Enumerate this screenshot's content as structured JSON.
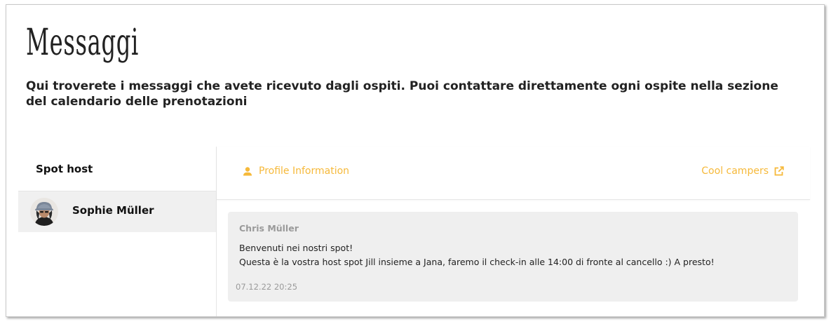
{
  "page": {
    "title": "Messaggi",
    "subtitle": "Qui troverete i messaggi che avete ricevuto dagli ospiti. Puoi contattare direttamente ogni ospite nella sezione del calendario delle prenotazioni"
  },
  "sidebar": {
    "header": "Spot host",
    "contacts": [
      {
        "name": "Sophie Müller",
        "avatar_icon": "avatar-photo"
      }
    ]
  },
  "chat": {
    "profile_link": {
      "label": "Profile Information",
      "icon": "person-icon"
    },
    "campers_link": {
      "label": "Cool campers",
      "icon": "external-link-icon"
    },
    "messages": [
      {
        "sender": "Chris Müller",
        "line1": "Benvenuti nei nostri spot!",
        "line2": "Questa è la vostra host spot Jill insieme a Jana, faremo il check-in alle 14:00 di fronte al cancello :)  A presto!",
        "timestamp": "07.12.22 20:25"
      }
    ]
  },
  "colors": {
    "accent": "#f6b93a",
    "muted_text": "#9a9a9a",
    "message_bg": "#efefef",
    "selected_contact_bg": "#f0f0f0"
  }
}
